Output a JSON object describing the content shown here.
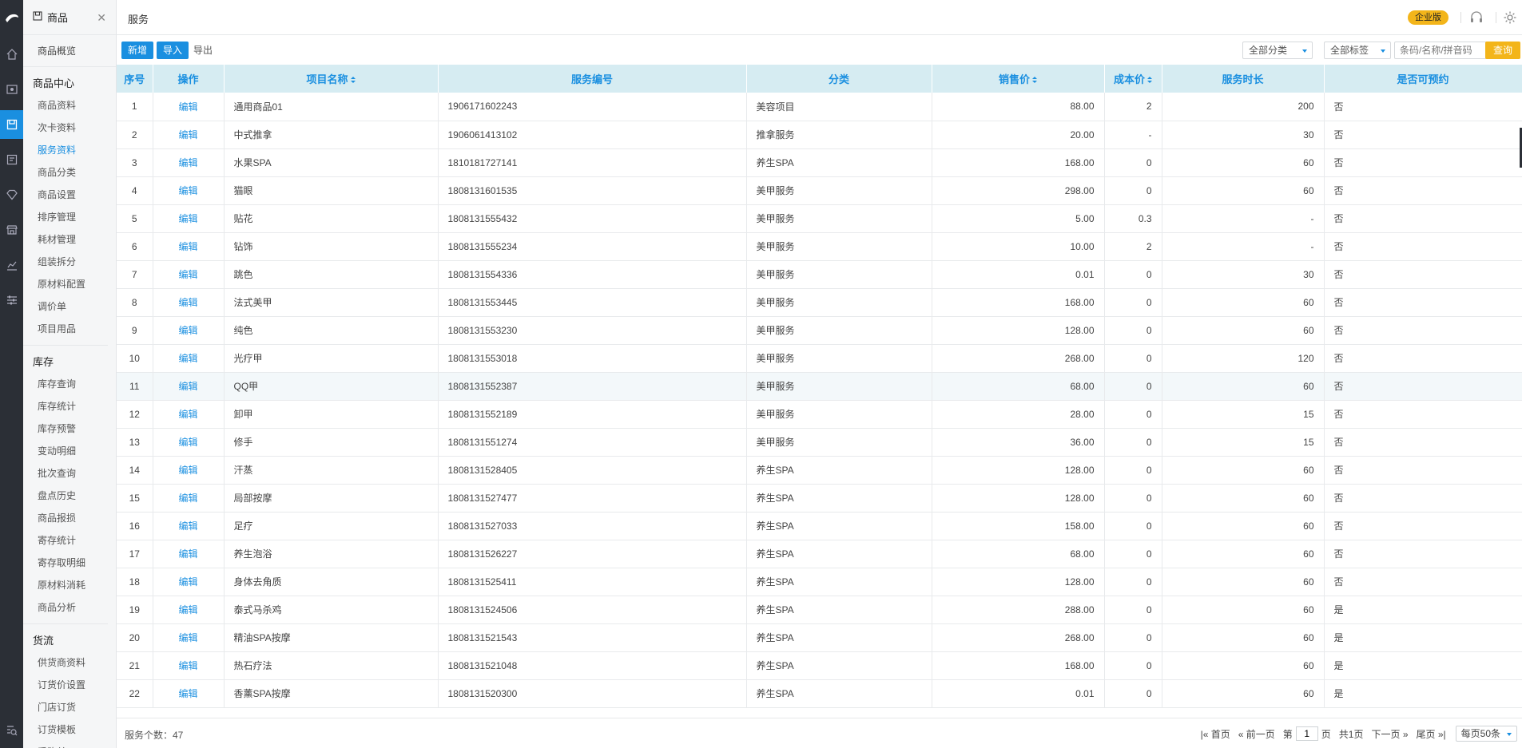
{
  "menu": {
    "header": "商品",
    "overview": "商品概览",
    "groups": [
      {
        "title": "商品中心",
        "items": [
          "商品资料",
          "次卡资料",
          "服务资料",
          "商品分类",
          "商品设置",
          "排序管理",
          "耗材管理",
          "组装拆分",
          "原材料配置",
          "调价单",
          "项目用品"
        ]
      },
      {
        "title": "库存",
        "items": [
          "库存查询",
          "库存统计",
          "库存预警",
          "变动明细",
          "批次查询",
          "盘点历史",
          "商品报损",
          "寄存统计",
          "寄存取明细",
          "原材料消耗",
          "商品分析"
        ]
      },
      {
        "title": "货流",
        "items": [
          "供货商资料",
          "订货价设置",
          "门店订货",
          "订货模板",
          "采购单"
        ]
      }
    ],
    "active_item": "服务资料"
  },
  "topbar": {
    "title": "服务",
    "badge": "企业版"
  },
  "toolbar": {
    "add_label": "新增",
    "import_label": "导入",
    "export_label": "导出",
    "category_select": "全部分类",
    "tag_select": "全部标签",
    "search_placeholder": "条码/名称/拼音码",
    "query_label": "查询"
  },
  "table": {
    "headers": [
      "序号",
      "操作",
      "项目名称",
      "服务编号",
      "分类",
      "销售价",
      "成本价",
      "服务时长",
      "是否可预约"
    ],
    "edit_label": "编辑",
    "rows": [
      [
        "1",
        "通用商品01",
        "1906171602243",
        "美容项目",
        "88.00",
        "2",
        "200",
        "否"
      ],
      [
        "2",
        "中式推拿",
        "1906061413102",
        "推拿服务",
        "20.00",
        "-",
        "30",
        "否"
      ],
      [
        "3",
        "水果SPA",
        "1810181727141",
        "养生SPA",
        "168.00",
        "0",
        "60",
        "否"
      ],
      [
        "4",
        "猫眼",
        "1808131601535",
        "美甲服务",
        "298.00",
        "0",
        "60",
        "否"
      ],
      [
        "5",
        "贴花",
        "1808131555432",
        "美甲服务",
        "5.00",
        "0.3",
        "-",
        "否"
      ],
      [
        "6",
        "钻饰",
        "1808131555234",
        "美甲服务",
        "10.00",
        "2",
        "-",
        "否"
      ],
      [
        "7",
        "跳色",
        "1808131554336",
        "美甲服务",
        "0.01",
        "0",
        "30",
        "否"
      ],
      [
        "8",
        "法式美甲",
        "1808131553445",
        "美甲服务",
        "168.00",
        "0",
        "60",
        "否"
      ],
      [
        "9",
        "纯色",
        "1808131553230",
        "美甲服务",
        "128.00",
        "0",
        "60",
        "否"
      ],
      [
        "10",
        "光疗甲",
        "1808131553018",
        "美甲服务",
        "268.00",
        "0",
        "120",
        "否"
      ],
      [
        "11",
        "QQ甲",
        "1808131552387",
        "美甲服务",
        "68.00",
        "0",
        "60",
        "否"
      ],
      [
        "12",
        "卸甲",
        "1808131552189",
        "美甲服务",
        "28.00",
        "0",
        "15",
        "否"
      ],
      [
        "13",
        "修手",
        "1808131551274",
        "美甲服务",
        "36.00",
        "0",
        "15",
        "否"
      ],
      [
        "14",
        "汗蒸",
        "1808131528405",
        "养生SPA",
        "128.00",
        "0",
        "60",
        "否"
      ],
      [
        "15",
        "局部按摩",
        "1808131527477",
        "养生SPA",
        "128.00",
        "0",
        "60",
        "否"
      ],
      [
        "16",
        "足疗",
        "1808131527033",
        "养生SPA",
        "158.00",
        "0",
        "60",
        "否"
      ],
      [
        "17",
        "养生泡浴",
        "1808131526227",
        "养生SPA",
        "68.00",
        "0",
        "60",
        "否"
      ],
      [
        "18",
        "身体去角质",
        "1808131525411",
        "养生SPA",
        "128.00",
        "0",
        "60",
        "否"
      ],
      [
        "19",
        "泰式马杀鸡",
        "1808131524506",
        "养生SPA",
        "288.00",
        "0",
        "60",
        "是"
      ],
      [
        "20",
        "精油SPA按摩",
        "1808131521543",
        "养生SPA",
        "268.00",
        "0",
        "60",
        "是"
      ],
      [
        "21",
        "热石疗法",
        "1808131521048",
        "养生SPA",
        "168.00",
        "0",
        "60",
        "是"
      ],
      [
        "22",
        "香薰SPA按摩",
        "1808131520300",
        "养生SPA",
        "0.01",
        "0",
        "60",
        "是"
      ]
    ],
    "highlighted_row": 11
  },
  "footer": {
    "count_label": "服务个数：47",
    "first": "首页",
    "prev": "前一页",
    "page_prefix": "第",
    "page_value": "1",
    "page_suffix": "页",
    "total_pages": "共1页",
    "next": "下一页",
    "last": "尾页",
    "per_page": "每页50条"
  },
  "colors": {
    "accent": "#1a8fe0",
    "query_button": "#f3b51a",
    "header_bg": "#d6ecf2",
    "rail_bg": "#2b2f36"
  }
}
